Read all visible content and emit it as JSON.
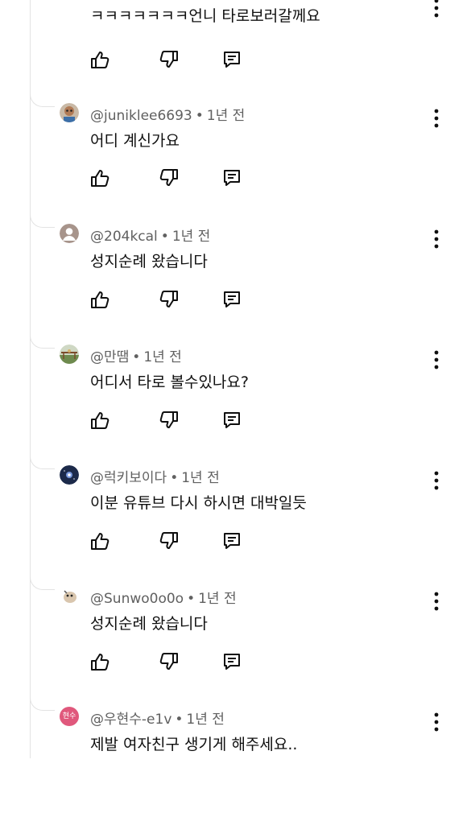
{
  "comments": [
    {
      "handle": "",
      "time": "",
      "text": "ㅋㅋㅋㅋㅋㅋㅋ언니 타로보러갈께요"
    },
    {
      "handle": "@juniklee6693",
      "time": "1년 전",
      "text": "어디 계신가요",
      "avatar": "avatar-photo-icon",
      "avatar_color": "#b07a55"
    },
    {
      "handle": "@204kcal",
      "time": "1년 전",
      "text": "성지순례 왔습니다",
      "avatar": "default-avatar-icon",
      "avatar_color": "#a7948b"
    },
    {
      "handle": "@만땜",
      "time": "1년 전",
      "text": "어디서 타로 볼수있나요?",
      "avatar": "landscape-avatar-icon",
      "avatar_color": "#6e8a4e"
    },
    {
      "handle": "@럭키보이다",
      "time": "1년 전",
      "text": "이분 유튜브 다시 하시면 대박일듯",
      "avatar": "night-sky-avatar-icon",
      "avatar_color": "#1c2a4a"
    },
    {
      "handle": "@Sunwo0o0o",
      "time": "1년 전",
      "text": "성지순례 왔습니다",
      "avatar": "cartoon-avatar-icon",
      "avatar_color": "#d9c6ae"
    },
    {
      "handle": "@우현수-e1v",
      "time": "1년 전",
      "text": "제발 여자친구 생기게 해주세요..",
      "avatar": "initials-avatar",
      "avatar_initials": "현수",
      "avatar_color": "#e0587c"
    }
  ],
  "colors": {
    "secondary_text": "#606060",
    "thread_line": "#e3e3e3",
    "icon": "#0f0f0f"
  }
}
